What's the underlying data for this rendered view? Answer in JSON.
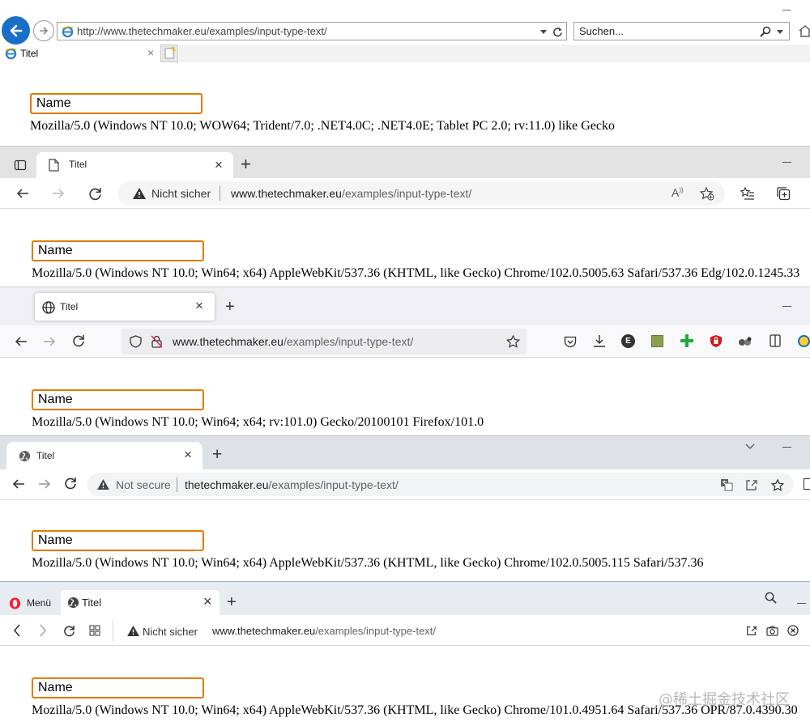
{
  "ie": {
    "url_host": "http://www.thetechmaker.eu",
    "url_path": "/examples/input-type-text/",
    "search_placeholder": "Suchen...",
    "tab_title": "Titel",
    "input_value": "Name",
    "user_agent": "Mozilla/5.0 (Windows NT 10.0; WOW64; Trident/7.0; .NET4.0C; .NET4.0E; Tablet PC 2.0; rv:11.0) like Gecko"
  },
  "edge": {
    "tab_title": "Titel",
    "security": "Nicht sicher",
    "url_host": "www.thetechmaker.eu",
    "url_path": "/examples/input-type-text/",
    "input_value": "Name",
    "user_agent": "Mozilla/5.0 (Windows NT 10.0; Win64; x64) AppleWebKit/537.36 (KHTML, like Gecko) Chrome/102.0.5005.63 Safari/537.36 Edg/102.0.1245.33"
  },
  "firefox": {
    "tab_title": "Titel",
    "url_host": "www.thetechmaker.eu",
    "url_path": "/examples/input-type-text/",
    "input_value": "Name",
    "user_agent": "Mozilla/5.0 (Windows NT 10.0; Win64; x64; rv:101.0) Gecko/20100101 Firefox/101.0"
  },
  "chrome": {
    "tab_title": "Titel",
    "security": "Not secure",
    "url_host": "thetechmaker.eu",
    "url_path": "/examples/input-type-text/",
    "input_value": "Name",
    "user_agent": "Mozilla/5.0 (Windows NT 10.0; Win64; x64) AppleWebKit/537.36 (KHTML, like Gecko) Chrome/102.0.5005.115 Safari/537.36"
  },
  "opera": {
    "menu_label": "Menü",
    "tab_title": "Titel",
    "security": "Nicht sicher",
    "url_host": "www.thetechmaker.eu",
    "url_path": "/examples/input-type-text/",
    "input_value": "Name",
    "user_agent": "Mozilla/5.0 (Windows NT 10.0; Win64; x64) AppleWebKit/537.36 (KHTML, like Gecko) Chrome/101.0.4951.64 Safari/537.36 OPR/87.0.4390.30"
  },
  "watermark": "@稀土掘金技术社区",
  "colors": {
    "input_border": "#e07b00",
    "ie_back_button": "#1a6ec8",
    "opera_red": "#ff1b2d"
  }
}
